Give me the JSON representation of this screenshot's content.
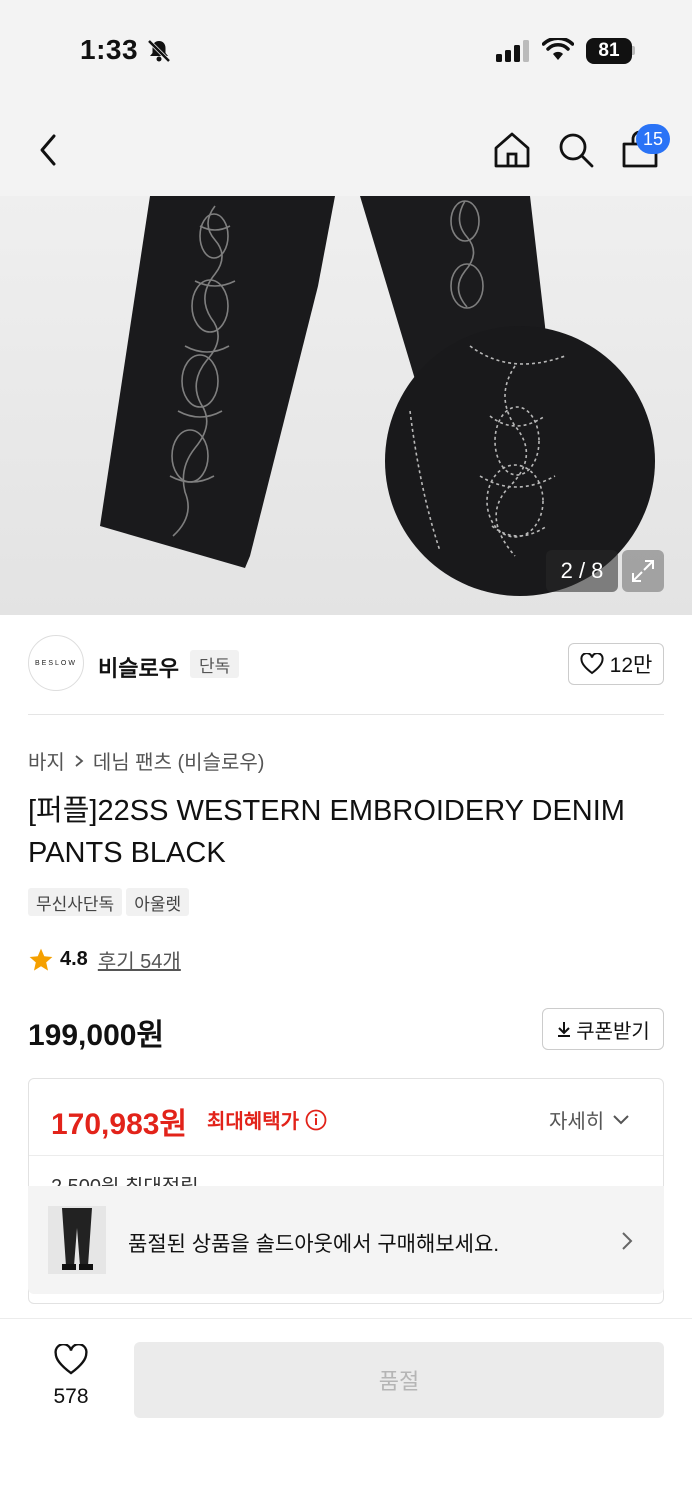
{
  "status_bar": {
    "time": "1:33",
    "battery": "81"
  },
  "header": {
    "cart_count": "15"
  },
  "gallery": {
    "counter": "2 / 8"
  },
  "brand": {
    "logo_text": "BESLOW",
    "name": "비슬로우",
    "tag": "단독",
    "likes": "12만"
  },
  "breadcrumb": {
    "category": "바지",
    "subcategory": "데님 팬츠 (비슬로우)"
  },
  "product": {
    "title": "[퍼플]22SS WESTERN EMBROIDERY DENIM PANTS BLACK",
    "chips": [
      "무신사단독",
      "아울렛"
    ],
    "rating": "4.8",
    "reviews": "후기 54개",
    "price": "199,000원",
    "coupon_label": "쿠폰받기"
  },
  "benefit": {
    "max_price": "170,983원",
    "max_label": "최대혜택가",
    "detail_label": "자세히",
    "partial_text": "2,500원 최대적립"
  },
  "soldout_banner": {
    "text": "품절된 상품을 솔드아웃에서 구매해보세요."
  },
  "bottom": {
    "wish_count": "578",
    "button_label": "품절"
  },
  "colors": {
    "accent_blue": "#2a73f6",
    "sale_red": "#e2231a",
    "star": "#f5a000"
  }
}
